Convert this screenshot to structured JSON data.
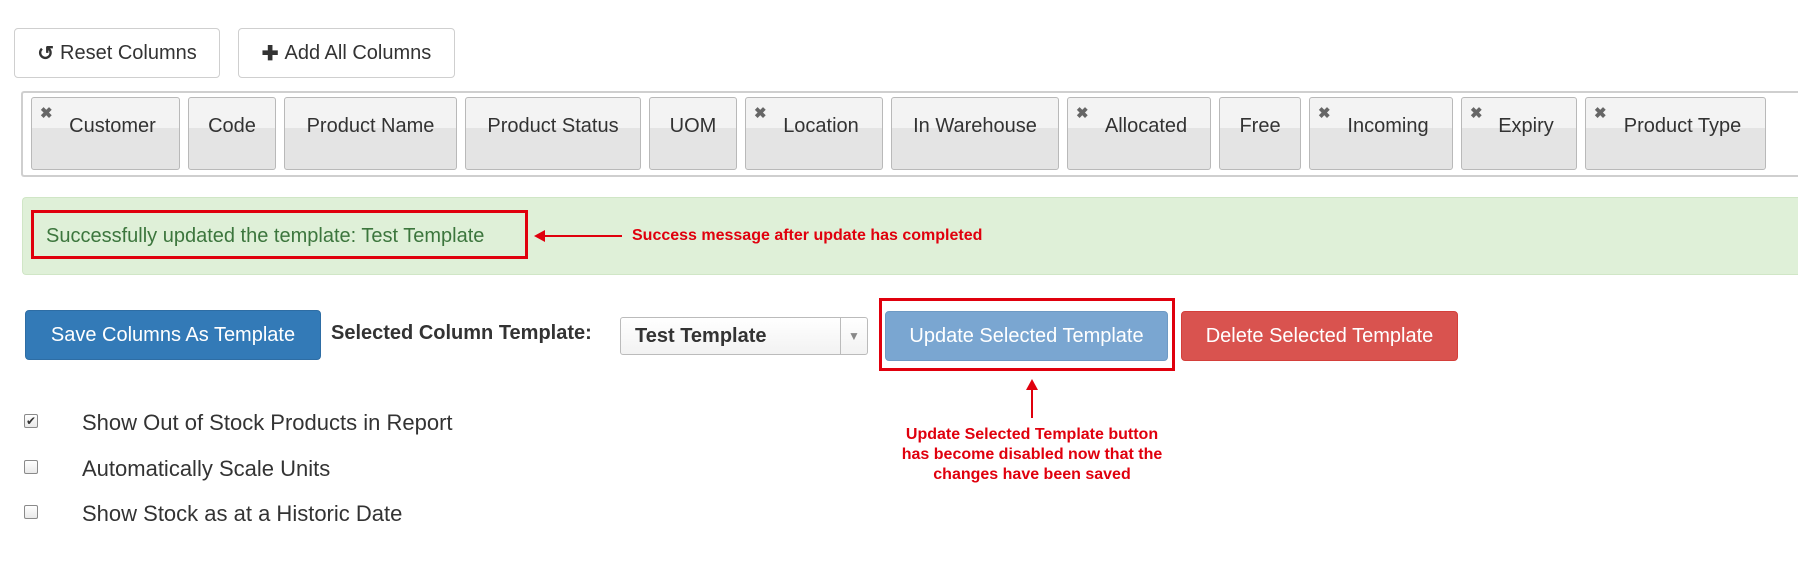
{
  "toolbar": {
    "reset_label": "Reset Columns",
    "reset_icon": "undo-icon",
    "add_all_label": "Add All Columns",
    "add_all_icon": "plus-icon"
  },
  "columns": [
    {
      "label": "Customer",
      "removable": true
    },
    {
      "label": "Code",
      "removable": false
    },
    {
      "label": "Product Name",
      "removable": false
    },
    {
      "label": "Product Status",
      "removable": false
    },
    {
      "label": "UOM",
      "removable": false
    },
    {
      "label": "Location",
      "removable": true
    },
    {
      "label": "In Warehouse",
      "removable": false
    },
    {
      "label": "Allocated",
      "removable": true
    },
    {
      "label": "Free",
      "removable": false
    },
    {
      "label": "Incoming",
      "removable": true
    },
    {
      "label": "Expiry",
      "removable": true
    },
    {
      "label": "Product Type",
      "removable": true
    }
  ],
  "alert": {
    "message": "Successfully updated the template: Test Template"
  },
  "annotations": {
    "success": "Success message after update has completed",
    "update_line1": "Update Selected Template button",
    "update_line2": "has become disabled now that the",
    "update_line3": "changes have been saved",
    "color": "#e0000d"
  },
  "actions": {
    "save_template_label": "Save Columns As Template",
    "selected_template_label": "Selected Column Template:",
    "selected_template_value": "Test Template",
    "update_label": "Update Selected Template",
    "delete_label": "Delete Selected Template"
  },
  "options": [
    {
      "label": "Show Out of Stock Products in Report",
      "checked": true
    },
    {
      "label": "Automatically Scale Units",
      "checked": false
    },
    {
      "label": "Show Stock as at a Historic Date",
      "checked": false
    }
  ],
  "colors": {
    "primary": "#337ab7",
    "info_disabled": "#7aa6d1",
    "danger": "#d9534f",
    "success_bg": "#dff0d8",
    "success_text": "#3c763d"
  }
}
